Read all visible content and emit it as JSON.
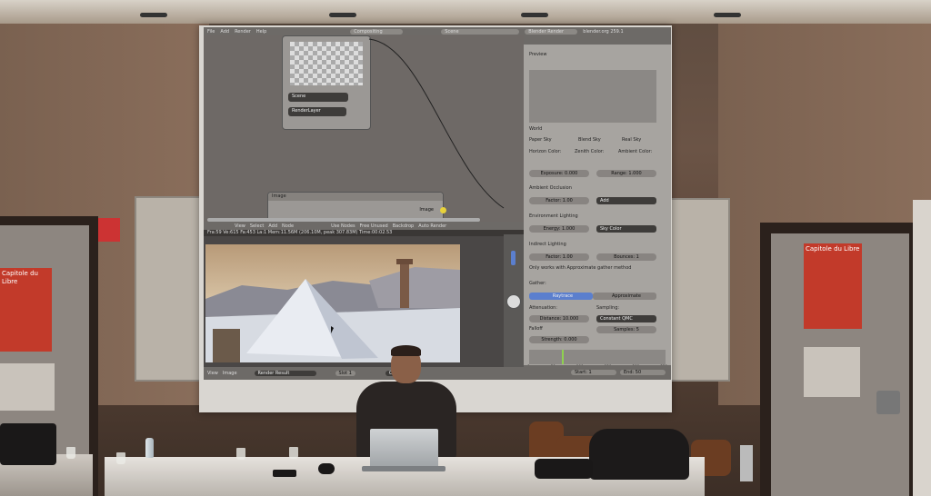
{
  "blender": {
    "menu": [
      "File",
      "Add",
      "Render",
      "Help"
    ],
    "screen_layout": "Compositing",
    "scene": "Scene",
    "render_engine": "Blender Render",
    "stats": "blender.org 259.1"
  },
  "nodes": {
    "render_layers": {
      "scene_label": "Scene",
      "layer_label": "RenderLayer"
    },
    "composite": {
      "title": "Image",
      "socket_label": "Image"
    }
  },
  "image_editor": {
    "header_items": [
      "View",
      "Select",
      "Add",
      "Node"
    ],
    "use_nodes": "Use Nodes",
    "free_unused": "Free Unused",
    "backdrop": "Backdrop",
    "auto_render": "Auto Render",
    "status": "Fra:59  Ve:615 Fa:453 La:1 Mem:11.56M (206.10M, peak 307.83M) Time:00:02.53",
    "footer": [
      "View",
      "Image"
    ],
    "image_name": "Render Result",
    "slot": "Slot 1",
    "pass": "Combined"
  },
  "properties": {
    "preview": "Preview",
    "world": "World",
    "paper_sky": "Paper Sky",
    "blend_sky": "Blend Sky",
    "real_sky": "Real Sky",
    "horizon_color": "Horizon Color:",
    "zenith_color": "Zenith Color:",
    "ambient_color": "Ambient Color:",
    "exposure": "Exposure: 0.000",
    "range": "Range: 1.000",
    "ambient_occlusion": "Ambient Occlusion",
    "ao_factor": "Factor: 1.00",
    "ao_mode": "Add",
    "environment_lighting": "Environment Lighting",
    "env_energy": "Energy: 1.000",
    "env_color": "Sky Color",
    "indirect_lighting": "Indirect Lighting",
    "ind_factor": "Factor: 1.00",
    "ind_bounces": "Bounces: 1",
    "ind_note": "Only works with Approximate gather method",
    "gather": "Gather:",
    "raytrace": "Raytrace",
    "approximate": "Approximate",
    "attenuation": "Attenuation:",
    "sampling": "Sampling:",
    "distance": "Distance: 10.000",
    "sampling_method": "Constant QMC",
    "falloff": "Falloff",
    "samples": "Samples: 5",
    "strength": "Strength: 0.000",
    "timeline_start": "Start: 1",
    "timeline_end": "End: 50",
    "timeline_ticks": [
      "0",
      "50",
      "100",
      "150",
      "200",
      "250"
    ]
  },
  "posters": {
    "left_title": "Capitole du Libre",
    "right_title": "Capitole du Libre"
  },
  "colors": {
    "poster_red": "#c23a2a",
    "ui_highlight": "#5b7fce",
    "wall": "#6b5446"
  }
}
